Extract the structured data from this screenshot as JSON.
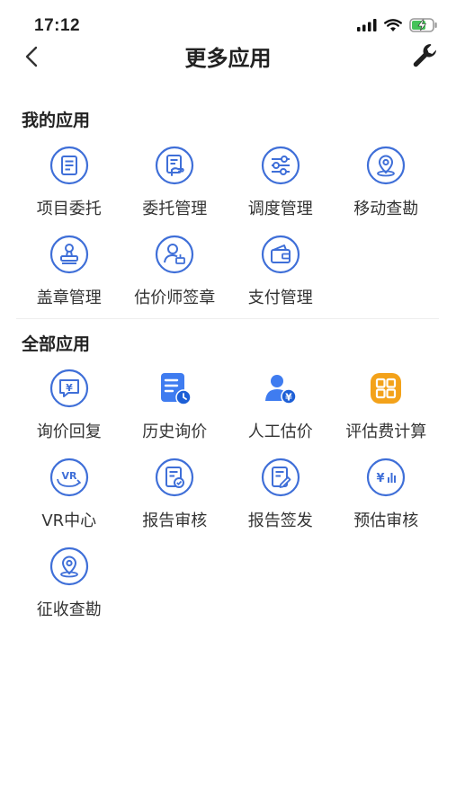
{
  "status": {
    "time": "17:12"
  },
  "header": {
    "title": "更多应用"
  },
  "my_apps": {
    "title": "我的应用",
    "items": [
      {
        "label": "项目委托",
        "icon": "document-list-icon"
      },
      {
        "label": "委托管理",
        "icon": "document-hand-icon"
      },
      {
        "label": "调度管理",
        "icon": "sliders-icon"
      },
      {
        "label": "移动查勘",
        "icon": "location-pin-icon"
      },
      {
        "label": "盖章管理",
        "icon": "stamp-icon"
      },
      {
        "label": "估价师签章",
        "icon": "user-stamp-icon"
      },
      {
        "label": "支付管理",
        "icon": "wallet-icon"
      }
    ]
  },
  "all_apps": {
    "title": "全部应用",
    "items": [
      {
        "label": "询价回复",
        "icon": "chat-yen-icon"
      },
      {
        "label": "历史询价",
        "icon": "document-clock-icon"
      },
      {
        "label": "人工估价",
        "icon": "user-yen-icon"
      },
      {
        "label": "评估费计算",
        "icon": "calculator-icon"
      },
      {
        "label": "VR中心",
        "icon": "vr-icon"
      },
      {
        "label": "报告审核",
        "icon": "document-check-icon"
      },
      {
        "label": "报告签发",
        "icon": "document-edit-icon"
      },
      {
        "label": "预估审核",
        "icon": "yen-chart-icon"
      },
      {
        "label": "征收查勘",
        "icon": "location-pin-icon"
      }
    ]
  },
  "colors": {
    "accent": "#3f6fd8",
    "orange": "#f3a21a"
  }
}
